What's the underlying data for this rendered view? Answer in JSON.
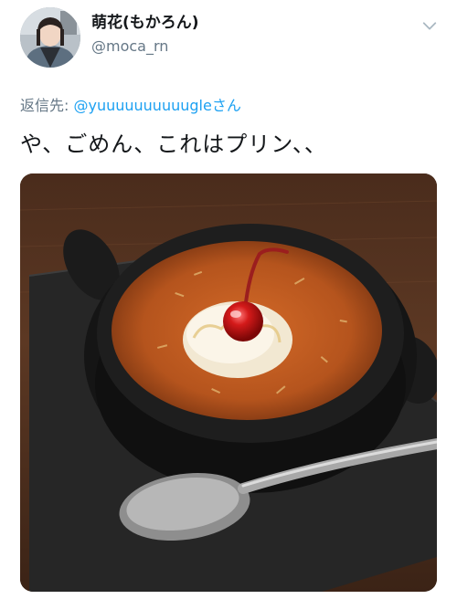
{
  "tweet": {
    "display_name": "萌花(もかろん)",
    "handle": "@moca_rn",
    "reply_prefix": "返信先: ",
    "reply_mention": "@yuuuuuuuuuugle",
    "reply_suffix": "さん",
    "text": "や、ごめん、これはプリン、、",
    "menu_icon": "chevron-down-icon"
  },
  "colors": {
    "name": "#14171a",
    "secondary": "#657786",
    "link": "#1da1f2",
    "background": "#ffffff"
  },
  "media": {
    "description_icon": "photo-pudding"
  }
}
